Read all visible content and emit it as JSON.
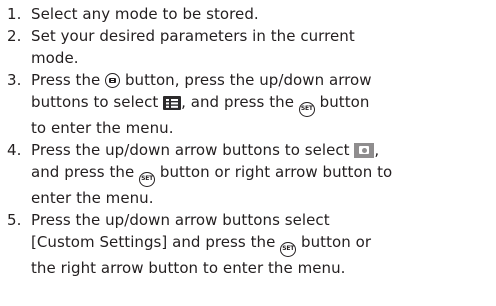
{
  "steps": [
    {
      "num": "1.",
      "text": "Select any mode to be stored."
    },
    {
      "num": "2.",
      "line1": "Set your desired parameters in the current",
      "line2": "mode."
    },
    {
      "num": "3.",
      "l1a": "Press the ",
      "l1b": " button, press the up/down arrow",
      "l2a": "buttons to select ",
      "l2b": ", and press the ",
      "l2c": " button",
      "l3": "to enter the menu."
    },
    {
      "num": "4.",
      "l1a": "Press the up/down arrow buttons to select ",
      "l1b": ",",
      "l2a": "and press the ",
      "l2b": " button or right arrow button to",
      "l3": "enter the menu."
    },
    {
      "num": "5.",
      "l1": "Press the up/down arrow buttons select",
      "l2a": "[Custom Settings] and press the ",
      "l2b": " button or",
      "l3": "the right arrow button to enter the menu."
    }
  ],
  "icons": {
    "menu_button": "menu-button-icon",
    "set_button": "set-button-icon",
    "set_button_text": "SET",
    "menu_symbol": "menu-list-icon",
    "camera_symbol": "camera-settings-icon"
  }
}
